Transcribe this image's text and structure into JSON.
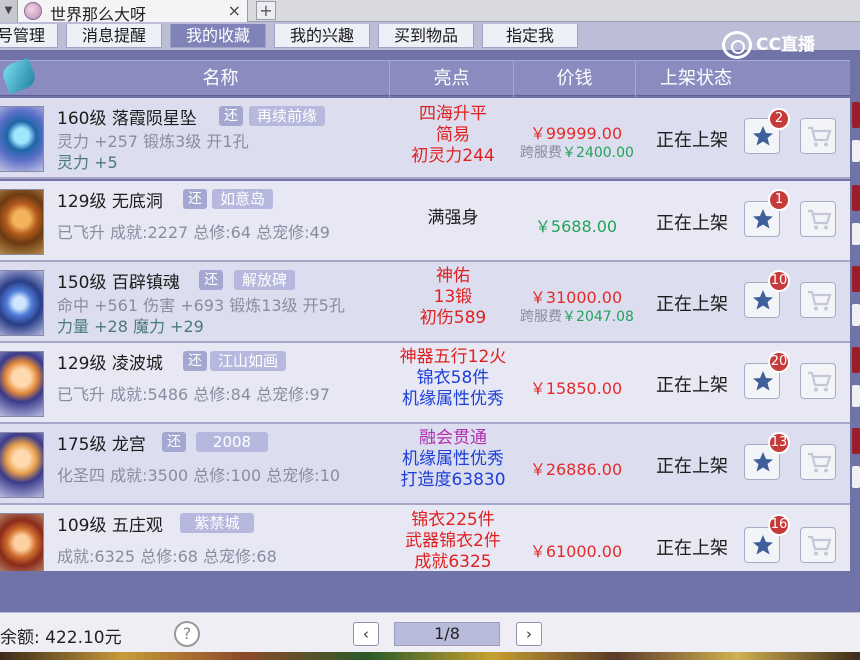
{
  "window": {
    "title": "世界那么大呀",
    "close_glyph": "×",
    "new_tab_glyph": "+",
    "dropdown_glyph": "▼"
  },
  "tabs": [
    "号管理",
    "消息提醒",
    "我的收藏",
    "我的兴趣",
    "买到物品",
    "指定我"
  ],
  "active_tab": "我的收藏",
  "logo": "CC直播",
  "columns": [
    "名称",
    "亮点",
    "价钱",
    "上架状态"
  ],
  "badge_label": "还",
  "rows": [
    {
      "name": "160级  落霞陨星坠",
      "has_badge": true,
      "tag": "再续前缘",
      "attr1": "灵力 +257  锻炼3级  开1孔",
      "attr2_label": "灵力",
      "attr2_value": "+5",
      "highlights": [
        {
          "text": "四海升平",
          "color": "#e02020"
        },
        {
          "text": "简易",
          "color": "#e02020"
        },
        {
          "text": "初灵力244",
          "color": "#e02020"
        }
      ],
      "price": "￥99999.00",
      "fee_label": "跨服费",
      "fee_value": "￥2400.00",
      "status": "正在上架",
      "star_count": "2"
    },
    {
      "name": "129级  无底洞",
      "has_badge": true,
      "tag": "如意岛",
      "attr1": "已飞升  成就:2227  总修:64  总宠修:49",
      "highlights": [
        {
          "text": "满强身",
          "color": "#1c1c1c"
        }
      ],
      "price": "￥5688.00",
      "price_green": true,
      "status": "正在上架",
      "star_count": "1"
    },
    {
      "name": "150级  百辟镇魂",
      "has_badge": true,
      "tag": "解放碑",
      "attr1": "命中 +561  伤害 +693  锻炼13级  开5孔",
      "attr2_label": "力量",
      "attr2_value": "+28  魔力  +29",
      "highlights": [
        {
          "text": "神佑",
          "color": "#e02020"
        },
        {
          "text": "13锻",
          "color": "#e02020"
        },
        {
          "text": "初伤589",
          "color": "#e02020"
        }
      ],
      "price": "￥31000.00",
      "fee_label": "跨服费",
      "fee_value": "￥2047.08",
      "status": "正在上架",
      "star_count": "10"
    },
    {
      "name": "129级  凌波城",
      "has_badge": true,
      "tag": "江山如画",
      "attr1": "已飞升  成就:5486  总修:84  总宠修:97",
      "highlights": [
        {
          "text": "神器五行12火",
          "color": "#e02020"
        },
        {
          "text": "锦衣58件",
          "color": "#1b3fd8"
        },
        {
          "text": "机缘属性优秀",
          "color": "#1b3fd8"
        }
      ],
      "price": "￥15850.00",
      "status": "正在上架",
      "star_count": "20"
    },
    {
      "name": "175级  龙宫",
      "has_badge": true,
      "tag": "2008",
      "attr1": "化圣四  成就:3500  总修:100  总宠修:10",
      "highlights": [
        {
          "text": "融会贯通",
          "color": "#b030b0"
        },
        {
          "text": "机缘属性优秀",
          "color": "#1b3fd8"
        },
        {
          "text": "打造度63830",
          "color": "#1b3fd8"
        }
      ],
      "price": "￥26886.00",
      "status": "正在上架",
      "star_count": "13"
    },
    {
      "name": "109级  五庄观",
      "has_badge": false,
      "tag": "紫禁城",
      "attr1": "成就:6325  总修:68  总宠修:68",
      "highlights": [
        {
          "text": "锦衣225件",
          "color": "#e02020"
        },
        {
          "text": "武器锦衣2件",
          "color": "#e02020"
        },
        {
          "text": "成就6325",
          "color": "#e02020"
        }
      ],
      "price": "￥61000.00",
      "status": "正在上架",
      "star_count": "16"
    }
  ],
  "footer": {
    "balance": "余额: 422.10元",
    "help": "?",
    "prev": "‹",
    "next": "›",
    "page": "1/8"
  }
}
